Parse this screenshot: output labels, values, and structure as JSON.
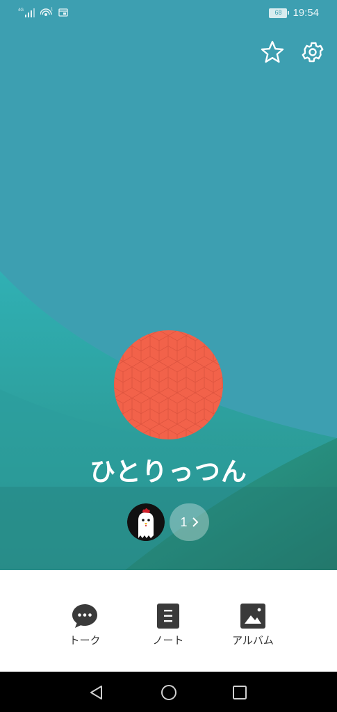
{
  "status_bar": {
    "network": "4G",
    "wifi_badge": "1",
    "battery": "68",
    "time": "19:54"
  },
  "colors": {
    "hero_bg": "#3c9fb0",
    "avatar": "#f2624a",
    "white": "#ffffff"
  },
  "profile": {
    "name": "ひとりっつん",
    "members_more": "1"
  },
  "actions": [
    {
      "label": "トーク",
      "icon": "chat-bubble-icon"
    },
    {
      "label": "ノート",
      "icon": "note-icon"
    },
    {
      "label": "アルバム",
      "icon": "album-icon"
    }
  ],
  "nav": {
    "back_icon": "back-triangle-icon",
    "home_icon": "home-circle-icon",
    "recent_icon": "recent-square-icon"
  }
}
